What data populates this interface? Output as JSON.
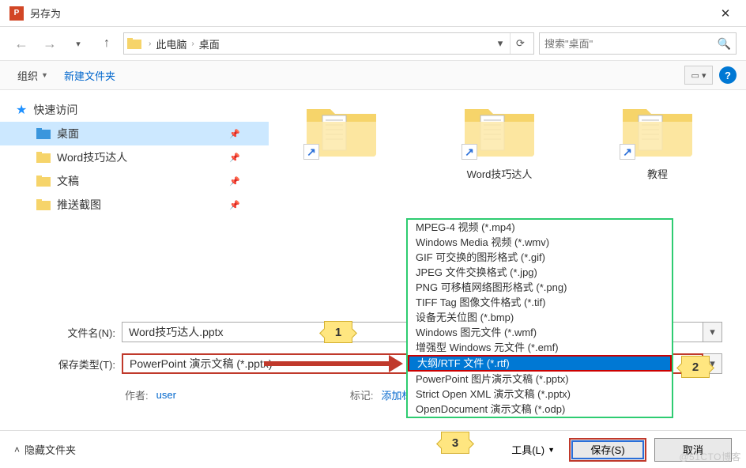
{
  "window": {
    "title": "另存为"
  },
  "nav": {
    "path_seg1": "此电脑",
    "path_seg2": "桌面",
    "search_placeholder": "搜索\"桌面\""
  },
  "toolbar": {
    "organize": "组织",
    "new_folder": "新建文件夹"
  },
  "sidebar": {
    "quick_access": "快速访问",
    "items": [
      {
        "label": "桌面"
      },
      {
        "label": "Word技巧达人"
      },
      {
        "label": "文稿"
      },
      {
        "label": "推送截图"
      }
    ]
  },
  "content": {
    "folders": [
      {
        "name": ""
      },
      {
        "name": "Word技巧达人"
      },
      {
        "name": "教程"
      }
    ]
  },
  "dropdown": {
    "options": [
      "MPEG-4 视频 (*.mp4)",
      "Windows Media 视频 (*.wmv)",
      "GIF 可交换的图形格式 (*.gif)",
      "JPEG 文件交换格式 (*.jpg)",
      "PNG 可移植网络图形格式 (*.png)",
      "TIFF Tag 图像文件格式 (*.tif)",
      "设备无关位图 (*.bmp)",
      "Windows 图元文件 (*.wmf)",
      "增强型 Windows 元文件 (*.emf)",
      "大纲/RTF 文件 (*.rtf)",
      "PowerPoint 图片演示文稿 (*.pptx)",
      "Strict Open XML 演示文稿 (*.pptx)",
      "OpenDocument 演示文稿 (*.odp)"
    ]
  },
  "fields": {
    "filename_label": "文件名(N):",
    "filename_value": "Word技巧达人.pptx",
    "filetype_label": "保存类型(T):",
    "filetype_value": "PowerPoint 演示文稿 (*.pptx)"
  },
  "meta": {
    "author_label": "作者:",
    "author_value": "user",
    "tag_label": "标记:",
    "tag_value": "添加标"
  },
  "callouts": {
    "c1": "1",
    "c2": "2",
    "c3": "3"
  },
  "footer": {
    "hide": "隐藏文件夹",
    "tools": "工具(L)",
    "save": "保存(S)",
    "cancel": "取消"
  },
  "watermark": "@51CTO博客"
}
